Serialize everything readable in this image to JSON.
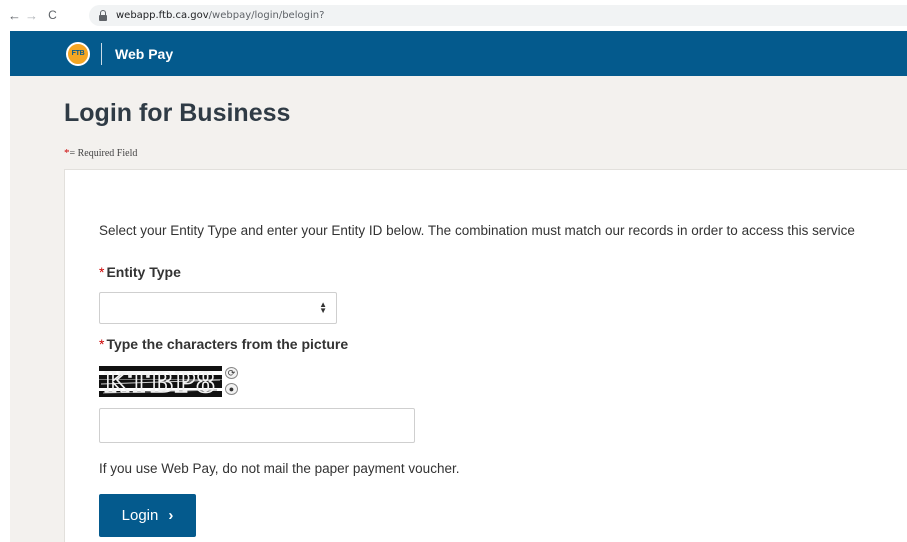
{
  "browser": {
    "url_host": "webapp.ftb.ca.gov",
    "url_path": "/webpay/login/belogin?"
  },
  "header": {
    "logo_text": "FTB",
    "title": "Web Pay"
  },
  "page": {
    "title": "Login for Business",
    "required_star": "*",
    "required_note": "= Required Field",
    "instructions": "Select your Entity Type and enter your Entity ID below. The combination must match our records in order to access this service"
  },
  "form": {
    "entity_type_label": "Entity Type",
    "entity_type_value": "",
    "captcha_label": "Type the characters from the picture",
    "captcha_text": "KTBP8",
    "captcha_value": "",
    "voucher_note": "If you use Web Pay, do not mail the paper payment voucher.",
    "login_label": "Login",
    "login_chevron": "›"
  },
  "colors": {
    "header_blue": "#045a8d",
    "page_bg": "#f3f1ee",
    "required_red": "#cc0000"
  }
}
